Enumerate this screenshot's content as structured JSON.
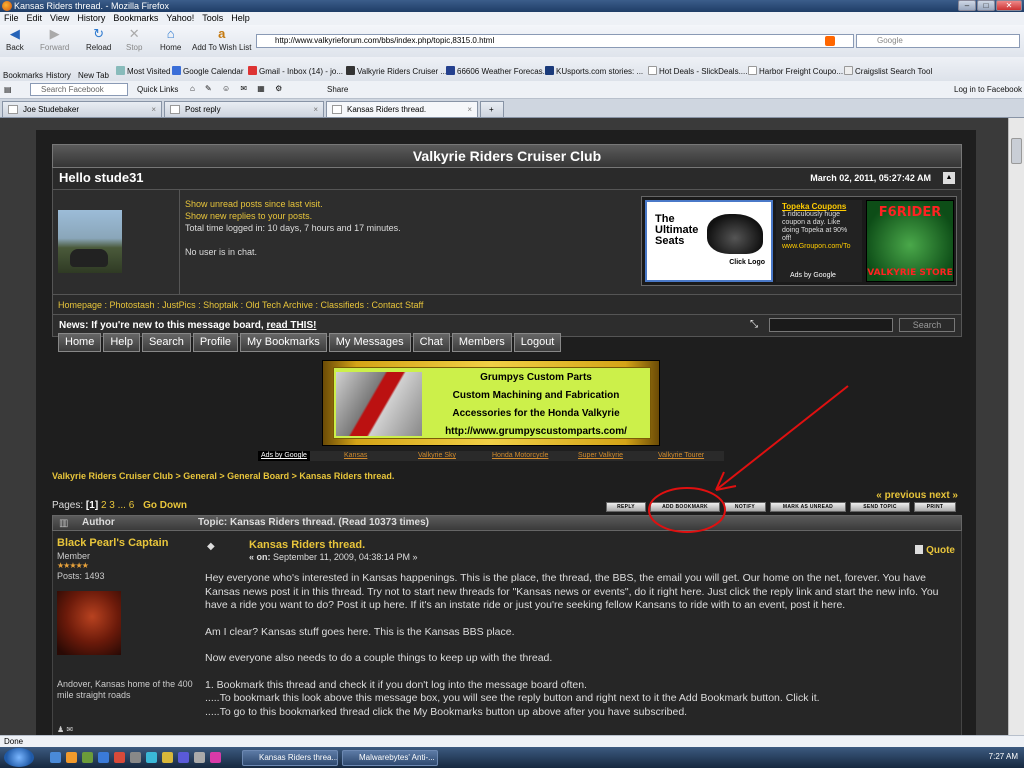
{
  "window": {
    "title": "Kansas Riders thread. - Mozilla Firefox"
  },
  "menu": [
    "File",
    "Edit",
    "View",
    "History",
    "Bookmarks",
    "Yahoo!",
    "Tools",
    "Help"
  ],
  "nav": {
    "back": "Back",
    "forward": "Forward",
    "reload": "Reload",
    "stop": "Stop",
    "home": "Home",
    "wishlist": "Add To Wish List",
    "url": "http://www.valkyrieforum.com/bbs/index.php/topic,8315.0.html",
    "search_placeholder": "Google"
  },
  "bookmarks": {
    "bookmarks_btn": "Bookmarks",
    "history_btn": "History",
    "newtab_btn": "New Tab",
    "items": [
      "Most Visited",
      "Google Calendar",
      "Gmail - Inbox (14) - jo...",
      "Valkyrie Riders Cruiser ...",
      "66606 Weather Forecas...",
      "KUsports.com stories: ...",
      "Hot Deals - SlickDeals....",
      "Harbor Freight Coupo...",
      "Craigslist Search Tool"
    ]
  },
  "fbbar": {
    "search_placeholder": "Search Facebook",
    "quicklinks": "Quick Links",
    "share": "Share",
    "login": "Log in to Facebook"
  },
  "tabs": [
    "Joe Studebaker",
    "Post reply",
    "Kansas Riders thread."
  ],
  "forum": {
    "site_title": "Valkyrie Riders Cruiser Club",
    "hello": "Hello stude31",
    "datetime": "March 02, 2011, 05:27:42 AM",
    "user_links": [
      "Show unread posts since last visit.",
      "Show new replies to your posts."
    ],
    "time_logged": "Total time logged in: 10 days, 7 hours and 17 minutes.",
    "chat_status": "No user is in chat.",
    "ads": {
      "ad1_title": "The Ultimate Seats",
      "ad1_click": "Click Logo",
      "ad2_title": "Topeka Coupons",
      "ad2_text": "1 ridiculously huge coupon a day. Like doing Topeka at 90% off!",
      "ad2_url": "www.Groupon.com/To",
      "ads_by_google": "Ads by Google",
      "ad3_top": "F6RIDER",
      "ad3_bottom": "VALKYRIE STORE"
    },
    "linkbar": "Homepage : Photostash : JustPics : Shoptalk : Old Tech Archive : Classifieds : Contact Staff",
    "news_label": "News:",
    "news_text": "If you're new to this message board, ",
    "news_link": "read THIS!",
    "search_btn": "Search",
    "navtabs": [
      "Home",
      "Help",
      "Search",
      "Profile",
      "My Bookmarks",
      "My Messages",
      "Chat",
      "Members",
      "Logout"
    ],
    "banner": [
      "Grumpys Custom Parts",
      "Custom Machining and Fabrication",
      "Accessories for the Honda Valkyrie",
      "http://www.grumpyscustomparts.com/"
    ],
    "adlinks": {
      "label": "Ads by Google",
      "links": [
        "Kansas",
        "Valkyrie Sky",
        "Honda Motorcycle",
        "Super Valkyrie",
        "Valkyrie Tourer"
      ]
    },
    "breadcrumb": "Valkyrie Riders Cruiser Club > General > General Board > Kansas Riders thread.",
    "pages": {
      "label": "Pages:",
      "current": "[1]",
      "others": "2 3 ... 6",
      "go_down": "Go Down",
      "prevnext": "« previous next »"
    },
    "actions": [
      "REPLY",
      "ADD BOOKMARK",
      "NOTIFY",
      "MARK AS UNREAD",
      "SEND TOPIC",
      "PRINT"
    ],
    "topic_header": {
      "author": "Author",
      "topic": "Topic: Kansas Riders thread.  (Read 10373 times)"
    },
    "post": {
      "author": "Black Pearl's Captain",
      "rank": "Member",
      "stars": "★★★★★",
      "posts": "Posts: 1493",
      "location": "Andover, Kansas home of the 400 mile straight roads",
      "title": "Kansas Riders thread.",
      "date_prefix": "« on:",
      "date": "September 11, 2009, 04:38:14 PM »",
      "quote": "Quote",
      "body": [
        "Hey everyone who's interested in Kansas happenings. This is the place, the thread, the BBS, the email you will get. Our home on the net, forever. You have Kansas news post it in this thread. Try not to start new threads for \"Kansas news or events\", do it right here. Just click the reply link and start the new info. You have a ride you want to do? Post it up here. If it's an instate ride or just you're seeking fellow Kansans to ride with to an event, post it here.",
        "Am I clear? Kansas stuff goes here. This is the Kansas BBS place.",
        "Now everyone also needs to do a couple things to keep up with the thread.",
        "1. Bookmark this thread and check it if you don't log into the message board often.",
        ".....To bookmark this look above this message box, you will see the reply button and right next to it the Add Bookmark button. Click it.",
        ".....To go to this bookmarked thread click the My Bookmarks button up above after you have subscribed."
      ]
    }
  },
  "status": "Done",
  "taskbar": {
    "items": [
      "Kansas Riders threa...",
      "Malwarebytes' Anti-..."
    ],
    "clock": "7:27 AM"
  }
}
